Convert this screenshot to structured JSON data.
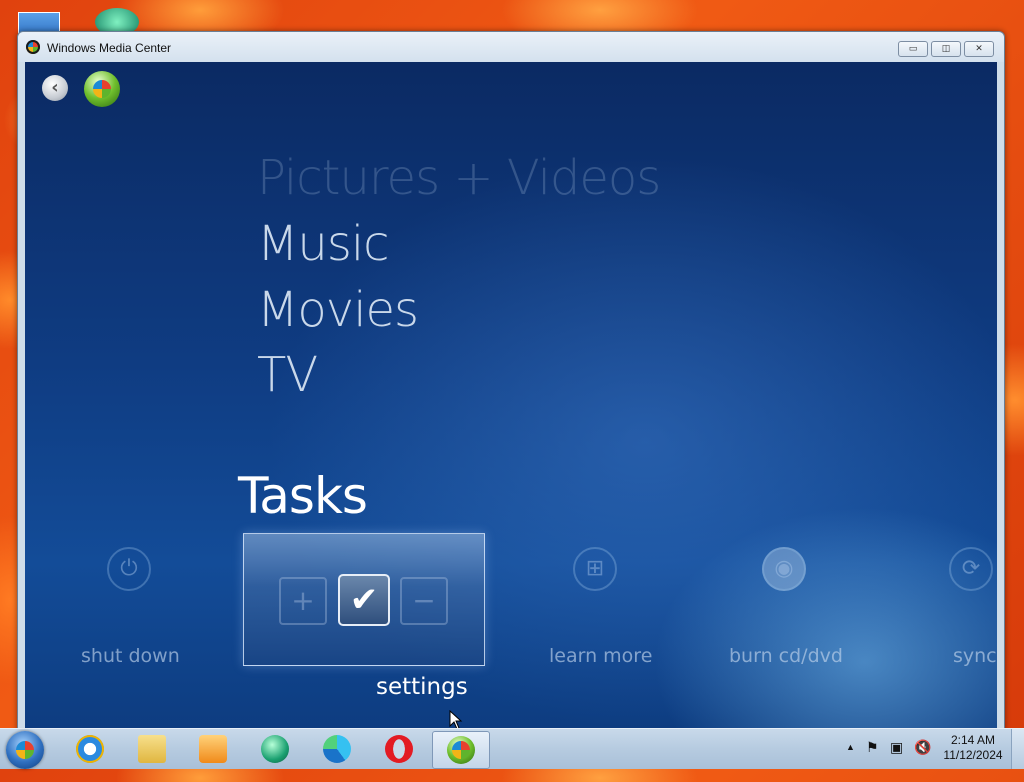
{
  "window": {
    "title": "Windows Media Center",
    "controls": {
      "minimize": "▭",
      "maximize": "◫",
      "close": "✕"
    }
  },
  "wmc": {
    "menu": [
      "Pictures + Videos",
      "Music",
      "Movies",
      "TV"
    ],
    "section_title": "Tasks",
    "tiles": [
      {
        "label": "shut down",
        "icon": "power-icon"
      },
      {
        "label": "settings",
        "icon": "checkmark-icon"
      },
      {
        "label": "learn more",
        "icon": "windows-logo-icon"
      },
      {
        "label": "burn cd/dvd",
        "icon": "disc-icon"
      },
      {
        "label": "sync",
        "icon": "sync-icon"
      }
    ],
    "focused_tile": "settings"
  },
  "taskbar": {
    "apps": [
      {
        "name": "Internet Explorer",
        "icon": "ie-icon"
      },
      {
        "name": "File Explorer",
        "icon": "folder-icon"
      },
      {
        "name": "Windows Media Player",
        "icon": "media-player-icon"
      },
      {
        "name": "Green app",
        "icon": "green-globe-icon"
      },
      {
        "name": "Microsoft Edge",
        "icon": "edge-icon"
      },
      {
        "name": "Opera",
        "icon": "opera-icon"
      },
      {
        "name": "Windows Media Center",
        "icon": "media-center-icon",
        "active": true
      }
    ],
    "clock": {
      "time": "2:14 AM",
      "date": "11/12/2024"
    }
  },
  "colors": {
    "accent": "#134c98",
    "taskbar": "#b6cbe0"
  }
}
